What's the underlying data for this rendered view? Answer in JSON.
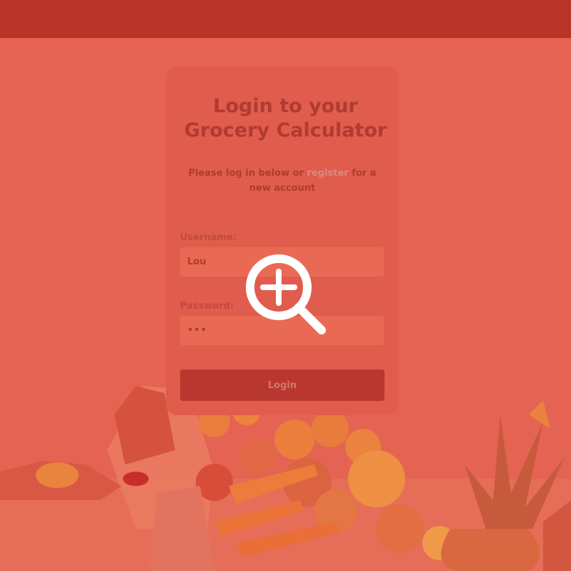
{
  "header": {},
  "login": {
    "title_line1": "Login to your",
    "title_line2": "Grocery Calculator",
    "subtitle_before": "Please log in below or ",
    "register_link": "register",
    "subtitle_after": " for a new account",
    "username_label": "Username:",
    "username_value": "Lou",
    "password_label": "Password:",
    "password_value": "•••",
    "login_button": "Login"
  },
  "overlay": {
    "icon": "zoom-in-icon"
  },
  "colors": {
    "overlay_red": "#e46352",
    "topbar": "#ba3427",
    "button": "#b8382f",
    "title_text": "#b13b30",
    "link": "#d48b85"
  }
}
